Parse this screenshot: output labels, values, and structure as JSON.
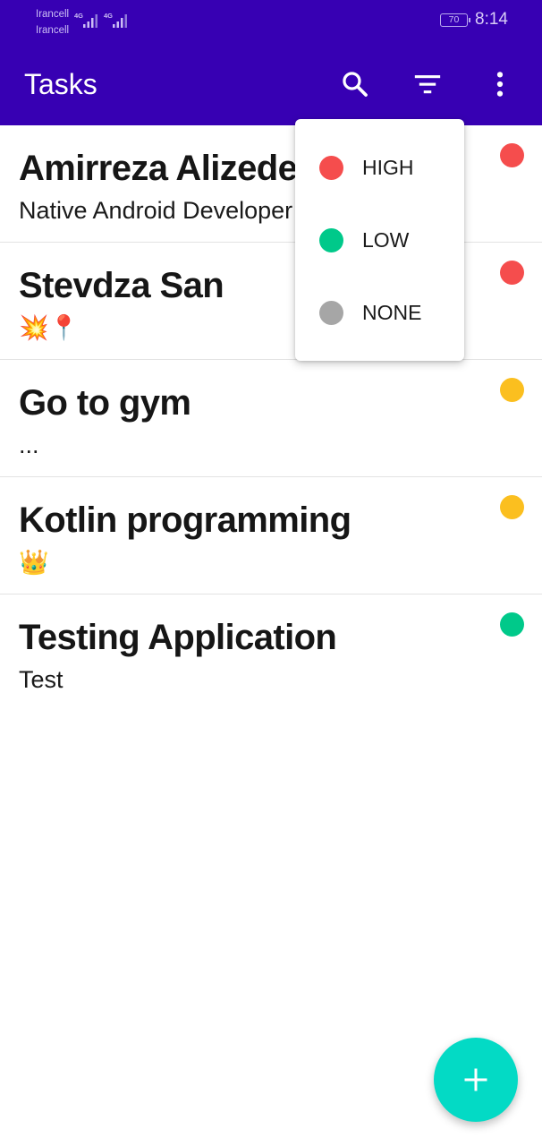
{
  "status_bar": {
    "carrier_1": "Irancell",
    "carrier_2": "Irancell",
    "network_1": "4G",
    "network_2": "4G",
    "battery_level": "70",
    "time": "8:14"
  },
  "app_bar": {
    "title": "Tasks",
    "background_color": "#3700b3",
    "actions": [
      {
        "icon": "search-icon"
      },
      {
        "icon": "filter-icon"
      },
      {
        "icon": "more-vert-icon"
      }
    ]
  },
  "priority_colors": {
    "HIGH": "#f54d4d",
    "MEDIUM": "#fbbf1f",
    "LOW": "#00c98a",
    "NONE": "#a6a6a6"
  },
  "tasks": [
    {
      "title": "Amirreza Alizedeh",
      "description": "Native Android Developer",
      "priority": "HIGH"
    },
    {
      "title": "Stevdza San",
      "description": "💥📍",
      "priority": "HIGH"
    },
    {
      "title": "Go to gym",
      "description": "...",
      "priority": "MEDIUM"
    },
    {
      "title": "Kotlin programming",
      "description": "👑",
      "priority": "MEDIUM"
    },
    {
      "title": "Testing Application",
      "description": "Test",
      "priority": "LOW"
    }
  ],
  "filter_menu": {
    "items": [
      {
        "label": "HIGH",
        "color": "#f54d4d"
      },
      {
        "label": "LOW",
        "color": "#00c98a"
      },
      {
        "label": "NONE",
        "color": "#a6a6a6"
      }
    ]
  },
  "fab": {
    "icon": "add-icon",
    "color": "#03dac5"
  }
}
